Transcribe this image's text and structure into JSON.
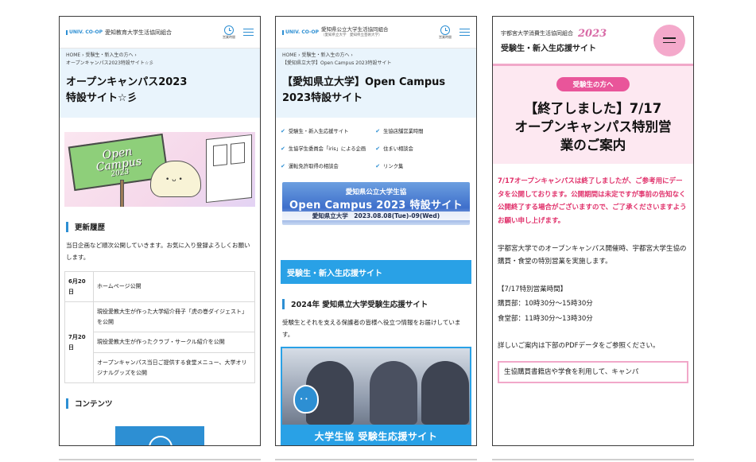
{
  "phone1": {
    "logo": {
      "mark": "UNIV. CO-OP",
      "name": "愛知教育大学生活協同組合"
    },
    "clock_label": "営業時間",
    "breadcrumbs": [
      "HOME",
      "›",
      "受験生・新入生の方へ",
      "›",
      "オープンキャンパス2023特設サイト☆彡"
    ],
    "title_line1": "オープンキャンパス2023",
    "title_line2": "特設サイト☆彡",
    "hero": {
      "sign_line1": "Open",
      "sign_line2": "Campus",
      "sign_line3": "2023"
    },
    "update_heading": "更新履歴",
    "update_intro": "当日企画など順次公開していきます。お気に入り登録よろしくお願いします。",
    "updates": [
      {
        "date": "6月20日",
        "text": "ホームページ公開"
      },
      {
        "date": "7月20日",
        "text": "現役愛教大生が作った大学紹介冊子「虎の巻ダイジェスト」を公開"
      },
      {
        "date": "",
        "text": "現役愛教大生が作ったクラブ・サークル紹介を公開"
      },
      {
        "date": "",
        "text": "オープンキャンパス当日ご提供する食堂メニュー、大学オリジナルグッズを公開"
      }
    ],
    "contents_heading": "コンテンツ"
  },
  "phone2": {
    "logo": {
      "mark": "UNIV. CO-OP",
      "name": "愛知県公立大学生活協同組合",
      "sub": "（愛知県立大学　愛知県立芸術大学）"
    },
    "clock_label": "営業時間",
    "breadcrumbs": [
      "HOME",
      "›",
      "受験生・新入生の方へ",
      "›",
      "【愛知県立大学】Open Campus 2023特設サイト"
    ],
    "title_line1": "【愛知県立大学】Open Campus",
    "title_line2": "2023特設サイト",
    "links": [
      "受験生・新入生応援サイト",
      "生協店舗営業時間",
      "生協学生委員会「iris」による企画",
      "住まい相談会",
      "運転免許取得の相談会",
      "リンク集"
    ],
    "banner": {
      "top": "愛知県公立大学生協",
      "main": "Open Campus 2023 特設サイト",
      "bottom": "愛知県立大学　2023.08.08(Tue)-09(Wed)"
    },
    "band_title": "受験生・新入生応援サイト",
    "sub_heading": "2024年 愛知県立大学受験生応援サイト",
    "intro": "受験生とそれを支える保護者の皆様へ役立つ情報をお届けしています。",
    "photo_caption": "大学生協 受験生応援サイト"
  },
  "phone3": {
    "org": "宇都宮大学消費生活協同組合",
    "year": "2023",
    "sub": "受験生・新入生応援サイト",
    "pill": "受験生の方へ",
    "title_line1": "【終了しました】7/17",
    "title_line2": "オープンキャンパス特別営",
    "title_line3": "業のご案内",
    "notice": "7/17オープンキャンパスは終了しましたが、ご参考用にデータを公開しております。公開期間は未定ですが事前の告知なく公開終了する場合がございますので、ご了承くださいますようお願い申し上げます。",
    "body1": "宇都宮大学でのオープンキャンパス開催時、宇都宮大学生協の購買・食堂の特別営業を実施します。",
    "hours_heading": "【7/17特別営業時間】",
    "hours_shop": "購買部：10時30分～15時30分",
    "hours_cafe": "食堂部：11時30分～13時30分",
    "body2": "詳しいご案内は下部のPDFデータをご参照ください。",
    "boxed": "生協購買書籍店や学食を利用して、キャンパ"
  }
}
